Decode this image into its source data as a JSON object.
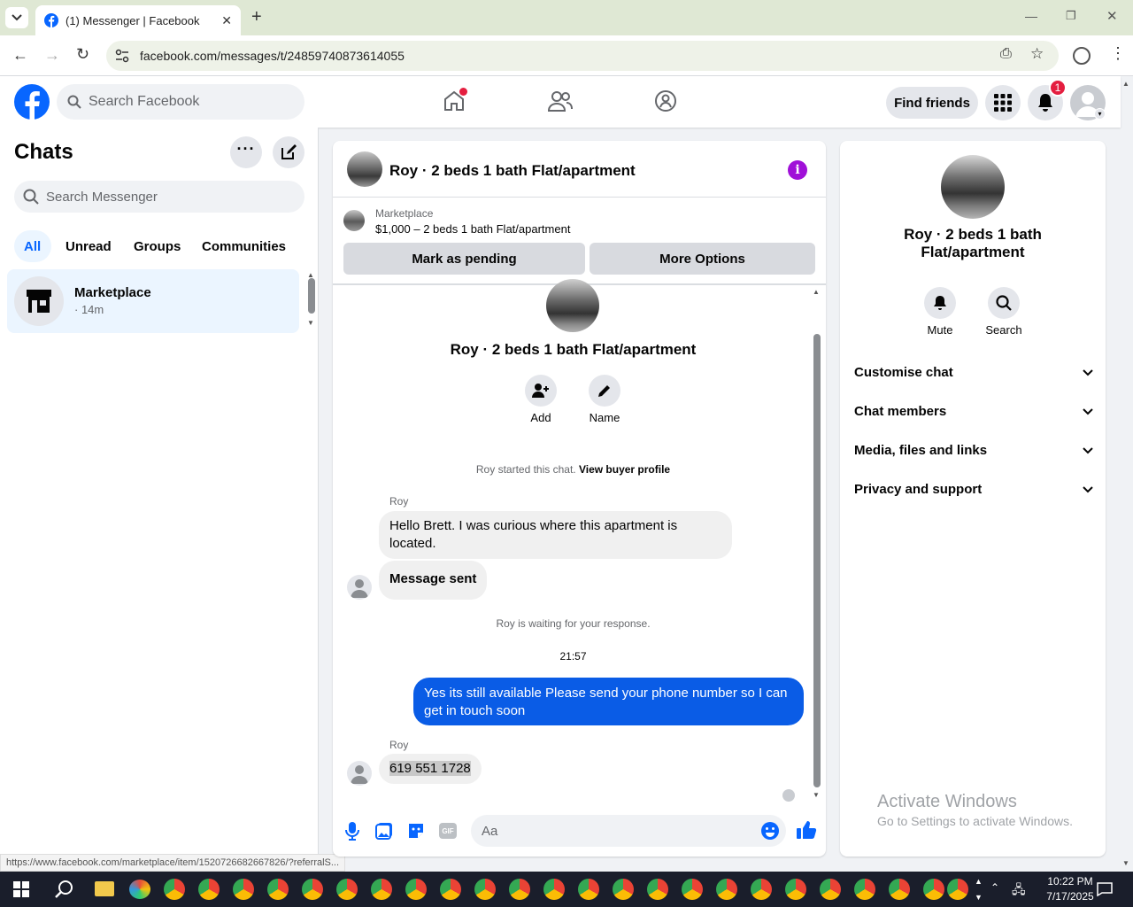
{
  "browser": {
    "tab_title": "(1) Messenger | Facebook",
    "url": "facebook.com/messages/t/24859740873614055",
    "status_url": "https://www.facebook.com/marketplace/item/1520726682667826/?referralS..."
  },
  "header": {
    "search_placeholder": "Search Facebook",
    "find_friends": "Find friends",
    "notif_count": "1"
  },
  "chats": {
    "title": "Chats",
    "search_placeholder": "Search Messenger",
    "filters": [
      "All",
      "Unread",
      "Groups",
      "Communities"
    ],
    "items": [
      {
        "name": "Marketplace",
        "time": "· 14m"
      }
    ]
  },
  "conversation": {
    "title": "Roy · 2 beds 1 bath Flat/apartment",
    "listing": {
      "source": "Marketplace",
      "price_title": "$1,000 – 2 beds 1 bath Flat/apartment"
    },
    "mark_pending": "Mark as pending",
    "more_options": "More Options",
    "profile_name": "Roy · 2 beds 1 bath Flat/apartment",
    "add": "Add",
    "name": "Name",
    "started_text": "Roy started this chat.",
    "view_buyer": "View buyer profile",
    "sender": "Roy",
    "msg1": "Hello Brett. I was curious where this apartment is located.",
    "msg2": "Message sent",
    "waiting": "Roy is waiting for your response.",
    "time": "21:57",
    "msg3": "Yes its still available Please send your phone number so I can get in touch soon",
    "sender2": "Roy",
    "msg4": "619 551 1728",
    "input_placeholder": "Aa"
  },
  "details": {
    "name": "Roy · 2 beds 1 bath Flat/apartment",
    "mute": "Mute",
    "search": "Search",
    "sections": [
      "Customise chat",
      "Chat members",
      "Media, files and links",
      "Privacy and support"
    ]
  },
  "watermark": {
    "line1": "Activate Windows",
    "line2": "Go to Settings to activate Windows."
  },
  "taskbar": {
    "time": "10:22 PM",
    "date": "7/17/2025"
  },
  "colors": {
    "fb_blue": "#0866ff",
    "my_bubble": "#0a5ce6",
    "accent_purple": "#a010d8"
  }
}
